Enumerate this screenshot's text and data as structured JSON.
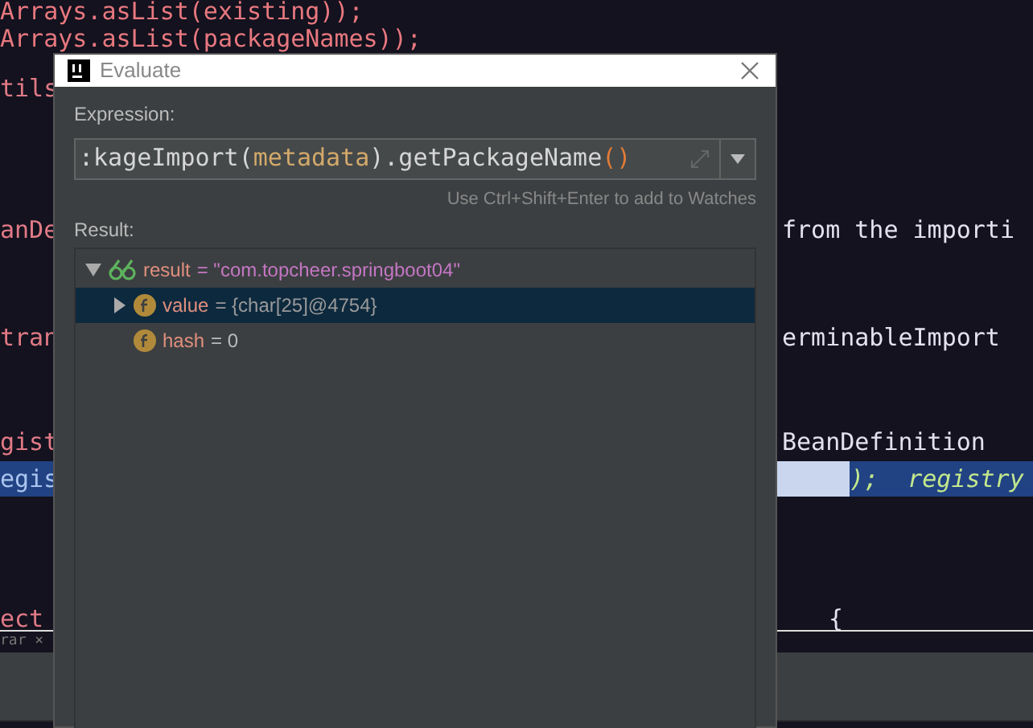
{
  "editor": {
    "lines": [
      {
        "left": "Arrays.asList(existing));",
        "selected": false
      },
      {
        "left": "Arrays.asList(packageNames));",
        "selected": false
      },
      {
        "left": "tils",
        "selected": false
      },
      {
        "left": "anDe",
        "right": "from the importi",
        "selected": false
      },
      {
        "left": "tran",
        "right": "erminableImport",
        "selected": false
      },
      {
        "left": "gist",
        "right": "BeanDefinition",
        "selected": false
      },
      {
        "left": "egis",
        "right": ");  registry",
        "selected": true
      },
      {
        "left": "ect",
        "right": "{",
        "selected": false
      }
    ],
    "tab": "rar ×"
  },
  "dialog": {
    "title": "Evaluate",
    "expression_label": "Expression:",
    "expression": ":kageImport(metadata).getPackageName()",
    "hint": "Use Ctrl+Shift+Enter to add to Watches",
    "result_label": "Result:",
    "tree": [
      {
        "name": "result",
        "value": "= \"com.topcheer.springboot04\"",
        "expanded": true,
        "selected": false,
        "children": [
          {
            "name": "value",
            "value": "= {char[25]@4754}",
            "expanded": false,
            "selected": true
          },
          {
            "name": "hash",
            "value": "= 0",
            "selected": false
          }
        ]
      }
    ]
  }
}
